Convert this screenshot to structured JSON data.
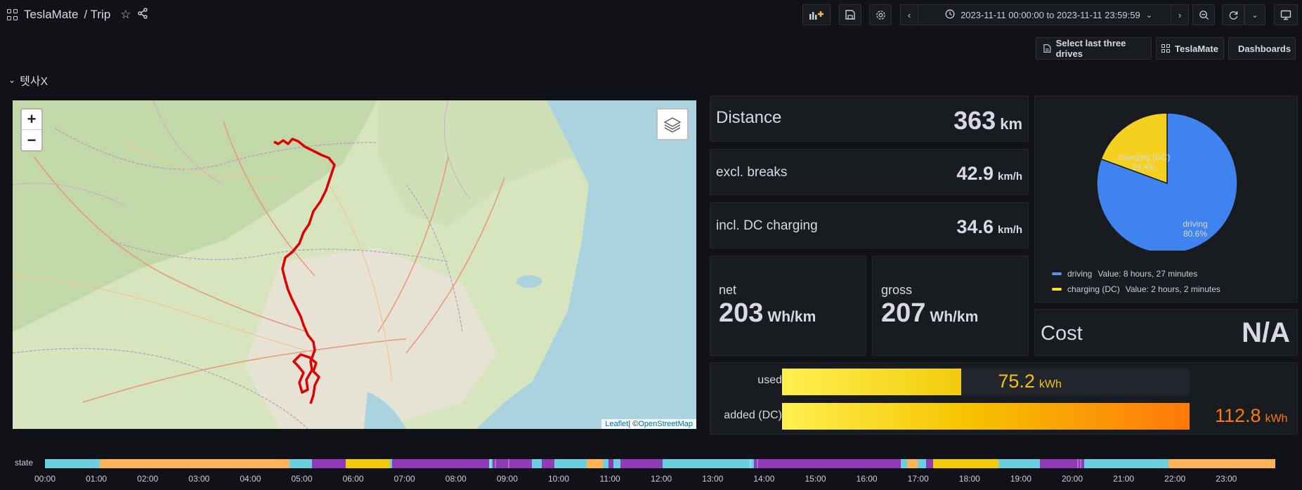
{
  "header": {
    "breadcrumb_root": "TeslaMate",
    "breadcrumb_page": "/ Trip",
    "time_range": "2023-11-11 00:00:00 to 2023-11-11 23:59:59"
  },
  "links": {
    "select_last_three_drives": "Select last three drives",
    "teslamate": "TeslaMate",
    "dashboards": "Dashboards"
  },
  "section": {
    "title": "텟사X"
  },
  "map": {
    "zoom_in": "+",
    "zoom_out": "−",
    "attribution_leaflet": "Leaflet",
    "attribution_sep": " | © ",
    "attribution_osm": "OpenStreetMap"
  },
  "stats": {
    "distance": {
      "label": "Distance",
      "value": "363",
      "unit": "km"
    },
    "excl_breaks": {
      "label": "excl. breaks",
      "value": "42.9",
      "unit": "km/h"
    },
    "incl_dc": {
      "label": "incl. DC charging",
      "value": "34.6",
      "unit": "km/h"
    },
    "net": {
      "label": "net",
      "value": "203",
      "unit": "Wh/km"
    },
    "gross": {
      "label": "gross",
      "value": "207",
      "unit": "Wh/km"
    },
    "cost": {
      "label": "Cost",
      "value": "N/A"
    }
  },
  "pie": {
    "slices": [
      {
        "name": "driving",
        "percent": 80.6,
        "percent_label": "80.6%",
        "color": "#1f60c4",
        "legend": "Value: 8 hours, 27 minutes"
      },
      {
        "name": "charging (DC)",
        "percent": 19.4,
        "percent_label": "19.4%",
        "color": "#e0b400",
        "legend": "Value: 2 hours, 2 minutes"
      }
    ]
  },
  "energy": {
    "used": {
      "label": "used",
      "value": "75.2",
      "unit": "kWh",
      "fraction": 0.667,
      "color": "#f2cc0c"
    },
    "added": {
      "label": "added (DC)",
      "value": "112.8",
      "unit": "kWh",
      "fraction": 1.0,
      "color": "#ff780a"
    }
  },
  "timeline": {
    "label": "state",
    "colors": {
      "online": "#6ccfe0",
      "charging": "#ffb357",
      "driving": "#8f3bb8",
      "asleep": "#f2cc0c"
    },
    "ticks": [
      "00:00",
      "01:00",
      "02:00",
      "03:00",
      "04:00",
      "05:00",
      "06:00",
      "07:00",
      "08:00",
      "09:00",
      "10:00",
      "11:00",
      "12:00",
      "13:00",
      "14:00",
      "15:00",
      "16:00",
      "17:00",
      "18:00",
      "19:00",
      "20:00",
      "21:00",
      "22:00",
      "23:00"
    ]
  }
}
